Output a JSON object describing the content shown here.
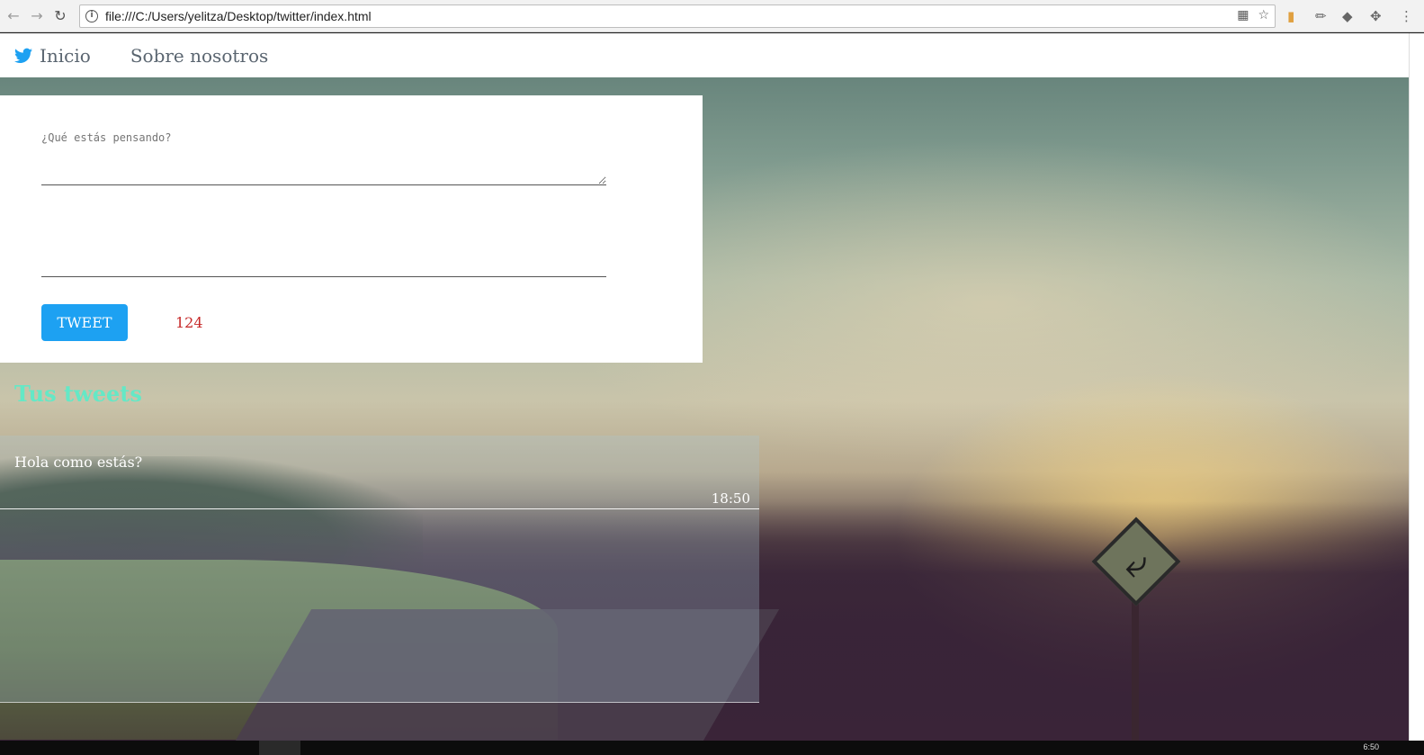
{
  "browser": {
    "url": "file:///C:/Users/yelitza/Desktop/twitter/index.html",
    "icons": [
      "back-arrow-icon",
      "forward-arrow-icon",
      "reload-icon",
      "info-icon",
      "translate-icon",
      "star-icon"
    ]
  },
  "navbar": {
    "inicio": "Inicio",
    "sobre": "Sobre nosotros"
  },
  "compose": {
    "placeholder": "¿Qué estás pensando?",
    "button_label": "TWEET",
    "counter": "124"
  },
  "tweets": {
    "title": "Tus tweets",
    "items": [
      {
        "text": "Hola como estás?",
        "time": "18:50"
      }
    ]
  },
  "taskbar": {
    "clock": "6:50"
  },
  "colors": {
    "accent": "#1da1f2",
    "title": "#64e8c6",
    "counter": "#c62828"
  }
}
